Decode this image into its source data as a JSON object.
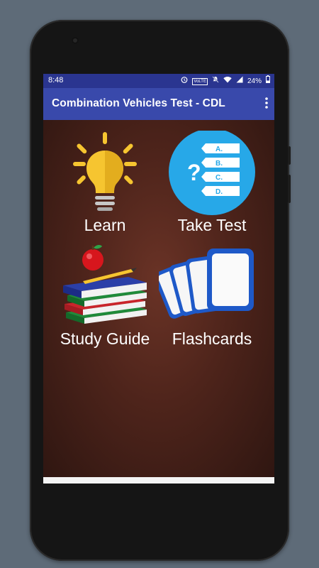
{
  "status_bar": {
    "time": "8:48",
    "volte": "VoLTE",
    "battery_percent": "24%",
    "icons": [
      "alarm-icon",
      "volte-badge",
      "mute-icon",
      "wifi-icon",
      "signal-icon",
      "battery-icon"
    ]
  },
  "app_bar": {
    "title": "Combination Vehicles Test - CDL",
    "overflow_icon": "more-vert-icon"
  },
  "menu": {
    "tiles": [
      {
        "label": "Learn",
        "icon": "lightbulb-icon"
      },
      {
        "label": "Take Test",
        "icon": "quiz-icon"
      },
      {
        "label": "Study Guide",
        "icon": "books-icon"
      },
      {
        "label": "Flashcards",
        "icon": "flashcards-icon"
      }
    ]
  },
  "quiz_icon_text": {
    "question_mark": "?",
    "options": [
      "A.",
      "B.",
      "C.",
      "D."
    ]
  },
  "colors": {
    "status_bar": "#2a3590",
    "app_bar": "#3949ab",
    "background": "#4e241b",
    "bulb": "#f6c530",
    "quiz_circle": "#27a8e8",
    "flashcards": "#1e59c8"
  }
}
